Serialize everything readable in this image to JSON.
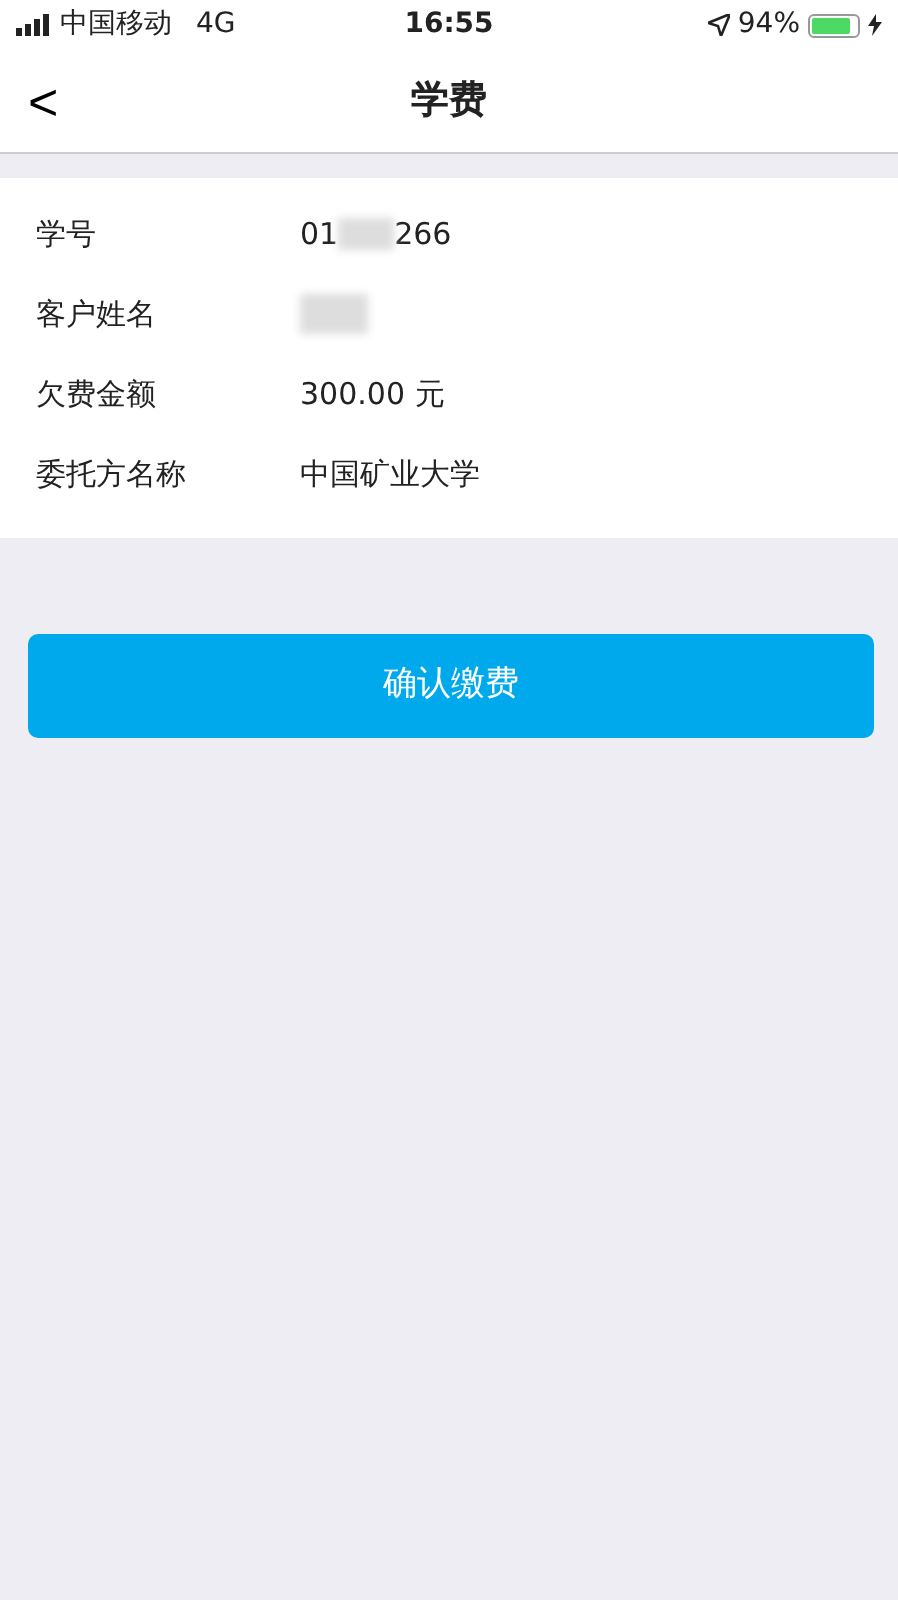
{
  "status_bar": {
    "carrier": "中国移动",
    "network": "4G",
    "time": "16:55",
    "battery": "94%"
  },
  "nav": {
    "back": "<",
    "title": "学费"
  },
  "rows": [
    {
      "label": "学号",
      "value_start": "01",
      "redacted": true,
      "value_end": "266"
    },
    {
      "label": "客户姓名",
      "redacted": true
    },
    {
      "label": "欠费金额",
      "value_start": "300.00 元",
      "redacted": false
    },
    {
      "label": "委托方名称",
      "value_start": "中国矿业大学",
      "redacted": false
    }
  ],
  "confirm_button": "确认缴费"
}
